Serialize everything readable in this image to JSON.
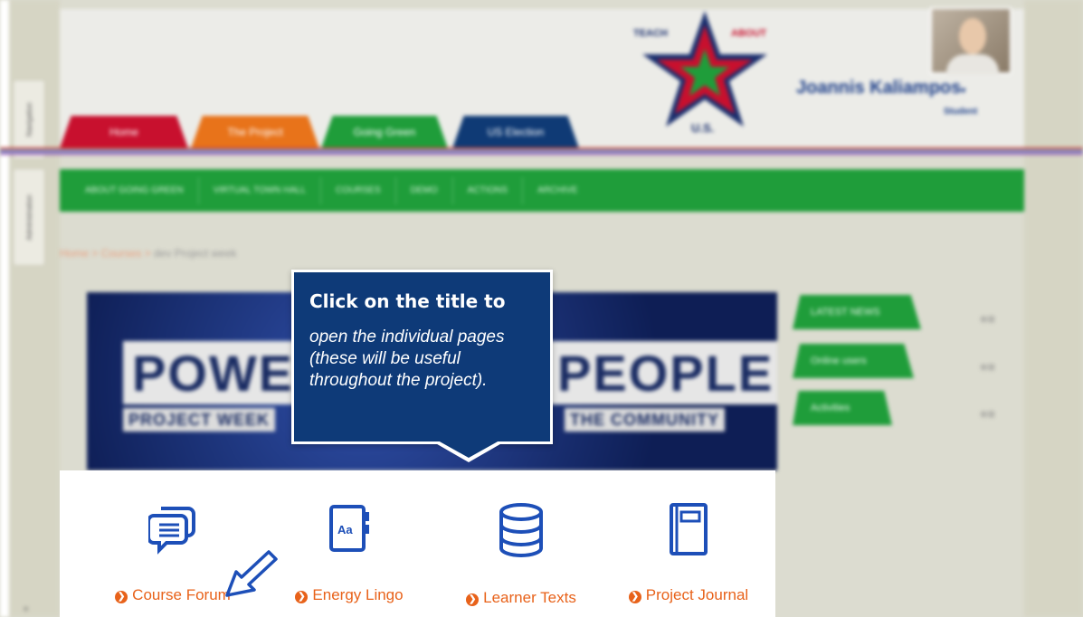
{
  "colors": {
    "accent": "#e8621a",
    "navy": "#0e3a78",
    "green": "#1f9d3a",
    "red": "#c8102e",
    "icon_blue": "#1d4fb8"
  },
  "sidebar": {
    "tabs": [
      "Navigation",
      "Administration"
    ],
    "footer": "≡"
  },
  "header": {
    "tabs": [
      "Home",
      "The Project",
      "Going Green",
      "US Election"
    ],
    "logo": {
      "left_text": "TEACH",
      "right_text": "ABOUT",
      "bottom_text": "U.S."
    },
    "user": {
      "name": "Joannis Kaliampos",
      "name_suffix": "▾",
      "role": "Student"
    }
  },
  "nav": {
    "items": [
      "ABOUT GOING GREEN",
      "VIRTUAL TOWN HALL",
      "COURSES",
      "DEMO",
      "ACTIONS",
      "ARCHIVE"
    ]
  },
  "breadcrumb": {
    "home": "Home",
    "courses": "Courses",
    "current": "dev Project week",
    "separator": ">"
  },
  "banner": {
    "word_left": "POWE",
    "word_right": "PEOPLE",
    "sub_left": "PROJECT WEEK",
    "sub_right": "THE COMMUNITY"
  },
  "blocks": {
    "items": [
      "LATEST NEWS",
      "Online users",
      "Activities"
    ],
    "control": "⊕⊞"
  },
  "features": [
    {
      "label": "Course Forum",
      "icon": "chat-bubbles-icon"
    },
    {
      "label": "Energy Lingo",
      "icon": "dictionary-icon"
    },
    {
      "label": "Learner Texts",
      "icon": "database-icon"
    },
    {
      "label": "Project Journal",
      "icon": "notebook-icon"
    }
  ],
  "bullet_glyph": "❯",
  "callout": {
    "title": "Click on the title to",
    "text": "open the individual pages (these will be useful throughout the project)."
  },
  "dictionary_icon_text": "Aa"
}
